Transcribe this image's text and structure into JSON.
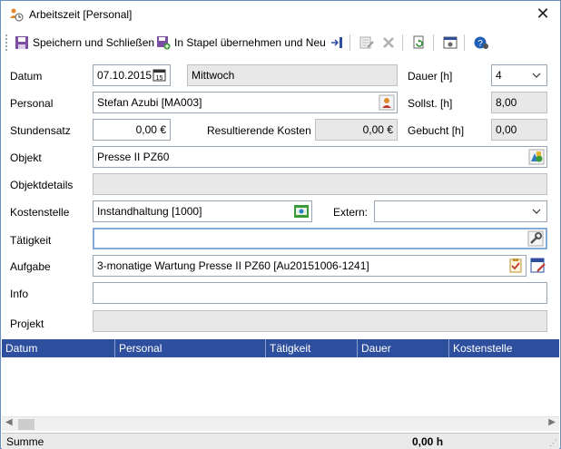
{
  "window": {
    "title": "Arbeitszeit [Personal]",
    "close_symbol": "✕"
  },
  "toolbar": {
    "save_close_label": "Speichern und Schließen",
    "batch_new_label": "In Stapel übernehmen und Neu"
  },
  "form": {
    "datum": {
      "label": "Datum",
      "value": "07.10.2015",
      "weekday": "Mittwoch"
    },
    "dauer": {
      "label": "Dauer [h]",
      "value": "4"
    },
    "personal": {
      "label": "Personal",
      "value": "Stefan Azubi [MA003]"
    },
    "sollst": {
      "label": "Sollst. [h]",
      "value": "8,00"
    },
    "stundensatz": {
      "label": "Stundensatz",
      "value": "0,00 €"
    },
    "resultierende_kosten": {
      "label": "Resultierende Kosten",
      "value": "0,00 €"
    },
    "gebucht": {
      "label": "Gebucht [h]",
      "value": "0,00"
    },
    "objekt": {
      "label": "Objekt",
      "value": "Presse II PZ60"
    },
    "objektdetails": {
      "label": "Objektdetails",
      "value": ""
    },
    "kostenstelle": {
      "label": "Kostenstelle",
      "value": "Instandhaltung [1000]"
    },
    "extern": {
      "label": "Extern:",
      "value": ""
    },
    "taetigkeit": {
      "label": "Tätigkeit",
      "value": ""
    },
    "aufgabe": {
      "label": "Aufgabe",
      "value": "3-monatige Wartung Presse II PZ60 [Au20151006-1241]"
    },
    "info": {
      "label": "Info",
      "value": ""
    },
    "projekt": {
      "label": "Projekt",
      "value": ""
    }
  },
  "grid": {
    "columns": [
      "Datum",
      "Personal",
      "Tätigkeit",
      "Dauer",
      "Kostenstelle"
    ],
    "rows": []
  },
  "footer": {
    "sum_label": "Summe",
    "sum_value": "0,00 h"
  },
  "colors": {
    "grid_header": "#2d4f9e",
    "focus_border": "#86abd8",
    "readonly_bg": "#e8e8e8"
  }
}
